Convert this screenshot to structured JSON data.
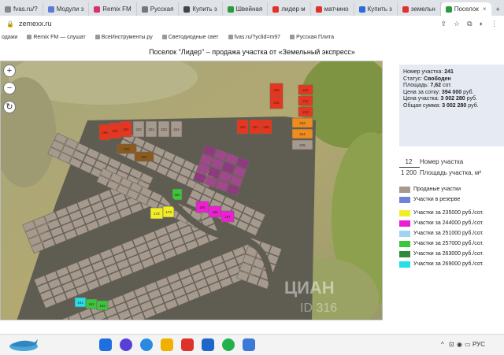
{
  "tabs": [
    {
      "label": "fvas.ru/?",
      "color": "#888888",
      "active": false
    },
    {
      "label": "Модули з",
      "color": "#5a7bd8",
      "active": false
    },
    {
      "label": "Remix FM",
      "color": "#d6336c",
      "active": false
    },
    {
      "label": "Русская",
      "color": "#777777",
      "active": false
    },
    {
      "label": "Купить з",
      "color": "#444444",
      "active": false
    },
    {
      "label": "Швейная",
      "color": "#2b9a3e",
      "active": false
    },
    {
      "label": "лидер м",
      "color": "#e0312b",
      "active": false
    },
    {
      "label": "матчино",
      "color": "#e0312b",
      "active": false
    },
    {
      "label": "Купить з",
      "color": "#2d6bd6",
      "active": false
    },
    {
      "label": "земельн",
      "color": "#e0312b",
      "active": false
    },
    {
      "label": "Поселок",
      "color": "#2b9a3e",
      "active": true
    }
  ],
  "tab_close": "×",
  "tab_new": "+",
  "address": {
    "lock": "🔒",
    "url": "zemexx.ru"
  },
  "bookmarks": [
    "одажи",
    "Remix FM — слушат",
    "ВсеИнструменты.ру",
    "Светодиодные свет",
    "fvas.ru/?yclid=m97",
    "Русская Плита"
  ],
  "page_title": "Поселок \"Лидер\" – продажа участка от «Земельный экспресс»",
  "map_controls": {
    "zoom_in": "+",
    "zoom_out": "−",
    "reset": "↻"
  },
  "lot_info": {
    "number_label": "Номер участка:",
    "number": "241",
    "status_label": "Статус:",
    "status": "Свободен",
    "area_label": "Площадь:",
    "area": "7,62",
    "area_unit": "сот.",
    "price_per_sotka_label": "Цена за сотку:",
    "price_per_sotka": "394 000",
    "currency": "руб.",
    "lot_price_label": "Цена участка:",
    "lot_price": "3 002 280",
    "total_label": "Общая сумма:",
    "total": "3 002 280"
  },
  "scale": {
    "top_num": "12",
    "top_label": "Номер участка",
    "bottom_num": "1 200",
    "bottom_label": "Площадь участка, м²"
  },
  "legend": [
    {
      "label": "Проданые участки",
      "color": "#a69a8f"
    },
    {
      "label": "Участки в резерве",
      "color": "#6f84d6"
    },
    {
      "label": "Участки за 235000 руб./сот.",
      "color": "#f0ee28"
    },
    {
      "label": "Участки за 244000 руб./сот.",
      "color": "#ec1fd4"
    },
    {
      "label": "Участки за 251000 руб./сот.",
      "color": "#9fd3f2"
    },
    {
      "label": "Участки за 257000 руб./сот.",
      "color": "#3cc63c"
    },
    {
      "label": "Участки за 263000 руб./сот.",
      "color": "#2e8b3a"
    },
    {
      "label": "Участки за 269000 руб./сот.",
      "color": "#23e0e6"
    }
  ],
  "map_lots": [
    {
      "n": "195",
      "c": "#e8351f"
    },
    {
      "n": "200",
      "c": "#e8351f"
    },
    {
      "n": "201",
      "c": "#e8351f"
    },
    {
      "n": "202",
      "c": "#a69a8f"
    },
    {
      "n": "222",
      "c": "#a69a8f"
    },
    {
      "n": "223",
      "c": "#a69a8f"
    },
    {
      "n": "224",
      "c": "#a69a8f"
    },
    {
      "n": "233",
      "c": "#e8351f"
    },
    {
      "n": "234",
      "c": "#e8351f"
    },
    {
      "n": "235",
      "c": "#e8351f"
    },
    {
      "n": "236",
      "c": "#e8351f"
    },
    {
      "n": "238",
      "c": "#e8351f"
    },
    {
      "n": "240",
      "c": "#e8351f"
    },
    {
      "n": "241",
      "c": "#e8351f"
    },
    {
      "n": "242",
      "c": "#e8351f"
    },
    {
      "n": "243",
      "c": "#f08c1e"
    },
    {
      "n": "244",
      "c": "#f08c1e"
    },
    {
      "n": "245",
      "c": "#a69a8f"
    },
    {
      "n": "203",
      "c": "#8a5a20"
    },
    {
      "n": "204",
      "c": "#8a5a20"
    },
    {
      "n": "181",
      "c": "#3cc63c"
    },
    {
      "n": "172",
      "c": "#f0ee28"
    },
    {
      "n": "173",
      "c": "#f0ee28"
    },
    {
      "n": "185",
      "c": "#ec1fd4"
    },
    {
      "n": "186",
      "c": "#ec1fd4"
    },
    {
      "n": "187",
      "c": "#ec1fd4"
    },
    {
      "n": "161",
      "c": "#23e0e6"
    },
    {
      "n": "162",
      "c": "#3cc63c"
    },
    {
      "n": "163",
      "c": "#3cc63c"
    }
  ],
  "watermark": "ЦИАН",
  "watermark_sub": "ID 316",
  "taskbar": {
    "lang": "РУС",
    "time": "",
    "date": ""
  },
  "tray_icons": [
    "^",
    "⊡",
    "◉",
    "▭"
  ]
}
